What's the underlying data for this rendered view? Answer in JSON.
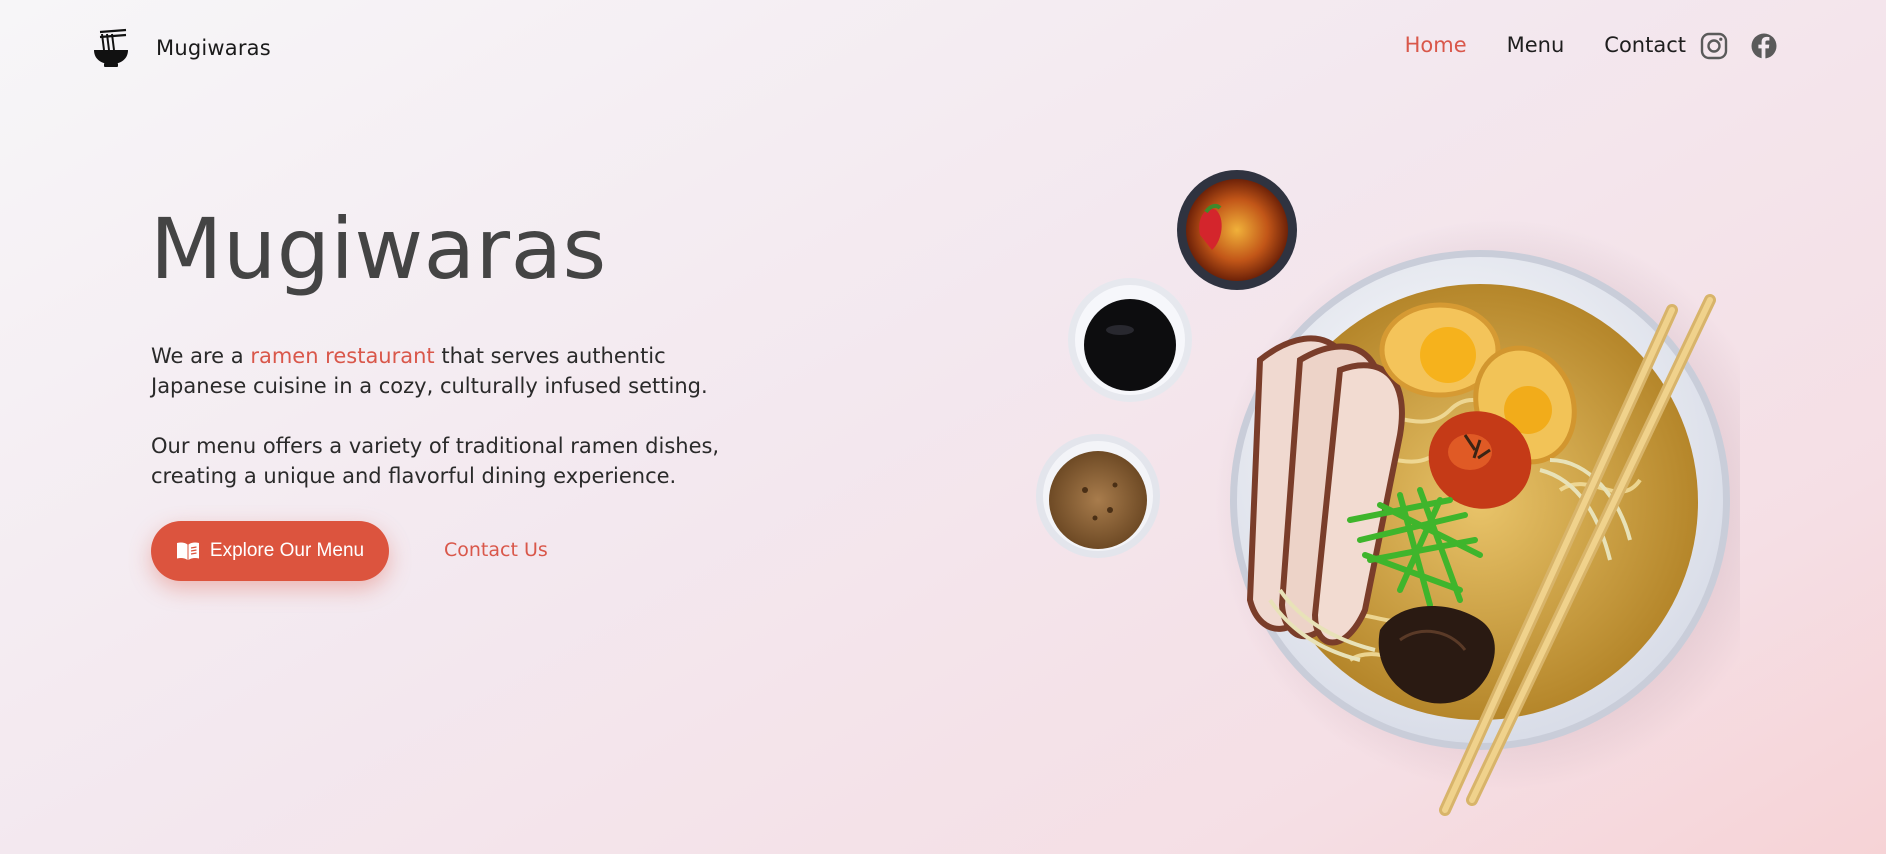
{
  "nav": {
    "brand": "Mugiwaras",
    "links": [
      {
        "label": "Home",
        "active": true
      },
      {
        "label": "Menu",
        "active": false
      },
      {
        "label": "Contact",
        "active": false
      }
    ],
    "social": [
      "instagram-icon",
      "facebook-icon"
    ]
  },
  "hero": {
    "title": "Mugiwaras",
    "p1_before": "We are a ",
    "p1_highlight": "ramen restaurant",
    "p1_after": " that serves authentic Japanese cuisine in a cozy, culturally infused setting.",
    "p2": "Our menu offers a variety of traditional ramen dishes, creating a unique and flavorful dining experience.",
    "primary_button": "Explore Our Menu",
    "secondary_button": "Contact Us"
  },
  "colors": {
    "accent": "#d9574a",
    "button": "#dc543e",
    "title": "#444444"
  }
}
